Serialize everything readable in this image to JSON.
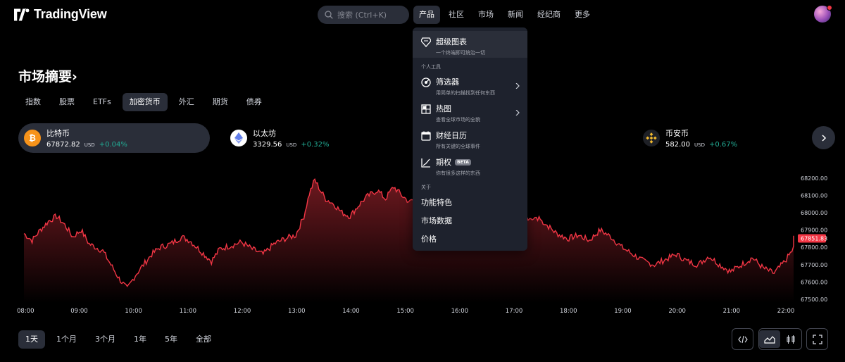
{
  "header": {
    "logo_text": "TradingView",
    "search_placeholder": "搜索 (Ctrl+K)",
    "nav": [
      "产品",
      "社区",
      "市场",
      "新闻",
      "经纪商",
      "更多"
    ]
  },
  "market": {
    "title": "市场摘要",
    "title_chevron": "›",
    "tabs": [
      "指数",
      "股票",
      "ETFs",
      "加密货币",
      "外汇",
      "期货",
      "债券"
    ],
    "active_tab": "加密货币",
    "assets": [
      {
        "name": "比特币",
        "price": "67872.82",
        "unit": "USD",
        "change": "+0.04%",
        "icon": "bitcoin-icon",
        "color": "#f7931a"
      },
      {
        "name": "以太坊",
        "price": "3329.56",
        "unit": "USD",
        "change": "+0.32%",
        "icon": "ethereum-icon",
        "color": "#ffffff"
      },
      {
        "name": "币安币",
        "price": "582.00",
        "unit": "USD",
        "change": "+0.67%",
        "icon": "bnb-icon",
        "color": "#f3ba2f"
      }
    ]
  },
  "dropdown": {
    "featured": {
      "label": "超级图表",
      "desc": "一个终端即可统治一切",
      "icon": "supercharts-icon"
    },
    "section_personal": "个人工具",
    "tools": [
      {
        "label": "筛选器",
        "desc": "用简单的扫描找到任何东西",
        "icon": "screener-icon",
        "has_chevron": true
      },
      {
        "label": "热图",
        "desc": "查看全球市场的全貌",
        "icon": "heatmap-icon",
        "has_chevron": true
      },
      {
        "label": "财经日历",
        "desc": "所有关键的全球事件",
        "icon": "calendar-icon",
        "has_chevron": false
      },
      {
        "label": "期权",
        "desc": "你有很多这样的东西",
        "icon": "options-icon",
        "has_chevron": false,
        "badge": "BETA"
      }
    ],
    "section_about": "关于",
    "about": [
      "功能特色",
      "市场数据",
      "价格"
    ]
  },
  "chart_data": {
    "type": "area",
    "x_ticks": [
      "08:00",
      "09:00",
      "10:00",
      "11:00",
      "12:00",
      "13:00",
      "14:00",
      "15:00",
      "16:00",
      "17:00",
      "18:00",
      "19:00",
      "20:00",
      "21:00",
      "22:00"
    ],
    "y_ticks": [
      68200.0,
      68100.0,
      68000.0,
      67900.0,
      67800.0,
      67700.0,
      67600.0,
      67500.0
    ],
    "ylim": [
      67480,
      68260
    ],
    "last_value": "67851.83",
    "line_color": "#f23645",
    "anchors": [
      [
        0,
        67880
      ],
      [
        0.15,
        67840
      ],
      [
        0.3,
        67900
      ],
      [
        0.45,
        67950
      ],
      [
        0.6,
        67980
      ],
      [
        0.75,
        67930
      ],
      [
        0.9,
        67860
      ],
      [
        1.05,
        67900
      ],
      [
        1.2,
        67820
      ],
      [
        1.45,
        67780
      ],
      [
        1.6,
        67700
      ],
      [
        1.75,
        67620
      ],
      [
        1.9,
        67560
      ],
      [
        2.05,
        67640
      ],
      [
        2.2,
        67700
      ],
      [
        2.35,
        67760
      ],
      [
        2.5,
        67800
      ],
      [
        2.7,
        67820
      ],
      [
        2.9,
        67860
      ],
      [
        3.05,
        67840
      ],
      [
        3.25,
        67780
      ],
      [
        3.45,
        67720
      ],
      [
        3.6,
        67790
      ],
      [
        3.8,
        67810
      ],
      [
        4.0,
        67830
      ],
      [
        4.2,
        67790
      ],
      [
        4.4,
        67760
      ],
      [
        4.6,
        67820
      ],
      [
        4.8,
        67850
      ],
      [
        5.0,
        67870
      ],
      [
        5.15,
        67980
      ],
      [
        5.25,
        68110
      ],
      [
        5.35,
        68190
      ],
      [
        5.45,
        68130
      ],
      [
        5.55,
        68080
      ],
      [
        5.7,
        68050
      ],
      [
        5.85,
        68000
      ],
      [
        6.0,
        67980
      ],
      [
        6.15,
        68040
      ],
      [
        6.3,
        68090
      ],
      [
        6.5,
        68130
      ],
      [
        6.65,
        68080
      ],
      [
        6.8,
        68150
      ],
      [
        6.95,
        68100
      ],
      [
        7.1,
        68060
      ],
      [
        7.25,
        68100
      ]
    ],
    "anchors_right": [
      [
        9.5,
        67960
      ],
      [
        9.65,
        67920
      ],
      [
        9.8,
        67880
      ],
      [
        10.0,
        67850
      ],
      [
        10.2,
        67870
      ],
      [
        10.4,
        67840
      ],
      [
        10.6,
        67900
      ],
      [
        10.8,
        67860
      ],
      [
        11.0,
        67800
      ],
      [
        11.2,
        67760
      ],
      [
        11.4,
        67720
      ],
      [
        11.6,
        67700
      ],
      [
        11.8,
        67730
      ],
      [
        12.0,
        67760
      ],
      [
        12.2,
        67720
      ],
      [
        12.4,
        67700
      ],
      [
        12.6,
        67750
      ],
      [
        12.8,
        67700
      ],
      [
        13.0,
        67660
      ],
      [
        13.2,
        67700
      ],
      [
        13.4,
        67740
      ],
      [
        13.6,
        67680
      ],
      [
        13.8,
        67650
      ],
      [
        14.0,
        67720
      ],
      [
        14.15,
        67790
      ],
      [
        14.3,
        67840
      ],
      [
        14.4,
        67852
      ]
    ]
  },
  "bottom": {
    "ranges": [
      "1天",
      "1个月",
      "3个月",
      "1年",
      "5年",
      "全部"
    ],
    "active_range": "1天"
  }
}
